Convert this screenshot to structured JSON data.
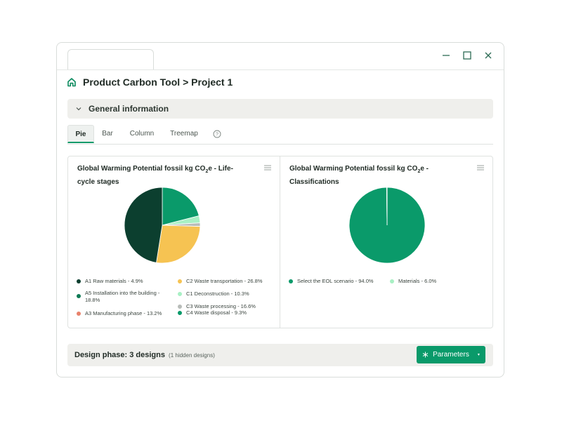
{
  "window": {
    "controls": {
      "minimize_icon": "minimize-icon",
      "maximize_icon": "maximize-icon",
      "close_icon": "close-icon"
    }
  },
  "header": {
    "icon": "home-icon",
    "title": "Product Carbon Tool > Project 1"
  },
  "section": {
    "icon": "chevron-down-icon",
    "title": "General information"
  },
  "tabs": [
    {
      "label": "Pie",
      "active": true
    },
    {
      "label": "Bar",
      "active": false
    },
    {
      "label": "Column",
      "active": false
    },
    {
      "label": "Treemap",
      "active": false
    }
  ],
  "help_icon": "help-icon",
  "charts": {
    "left": {
      "title_pre": "Global Warming Potential fossil kg CO",
      "title_sub": "2",
      "title_post": "e - Life-cycle stages"
    },
    "right": {
      "title_pre": "Global Warming Potential fossil kg CO",
      "title_sub": "2",
      "title_post": "e - Classifications"
    }
  },
  "chart_data": [
    {
      "type": "pie",
      "title": "Global Warming Potential fossil kg CO2e - Life-cycle stages",
      "legend_position": "bottom",
      "slices": [
        {
          "label": "A1 Raw materials - 4.9%",
          "value": 4.9,
          "color": "#0c3f2f"
        },
        {
          "label": "A5 Installation into the building - 18.8%",
          "value": 18.8,
          "color": "#0f7a55"
        },
        {
          "label": "A3 Manufacturing phase - 13.2%",
          "value": 13.2,
          "color": "#e8826b"
        },
        {
          "label": "C2 Waste transportation - 26.8%",
          "value": 26.8,
          "color": "#f6c352"
        },
        {
          "label": "C1 Deconstruction - 10.3%",
          "value": 10.3,
          "color": "#a8f0c4"
        },
        {
          "label": "C3 Waste processing - 16.6%",
          "value": 16.6,
          "color": "#b8bcb9"
        },
        {
          "label": "C4 Waste disposal - 9.3%",
          "value": 9.3,
          "color": "#0a9a6a"
        }
      ],
      "rendered_sectors": [
        {
          "value": 21,
          "color": "#0a9a6a"
        },
        {
          "value": 3,
          "color": "#a8f0c4"
        },
        {
          "value": 1.5,
          "color": "#b8bcb9"
        },
        {
          "value": 27,
          "color": "#f6c352"
        },
        {
          "value": 47.5,
          "color": "#0c3f2f"
        }
      ]
    },
    {
      "type": "pie",
      "title": "Global Warming Potential fossil kg CO2e - Classifications",
      "legend_position": "bottom",
      "slices": [
        {
          "label": "Select the EOL scenario - 94.0%",
          "value": 94.0,
          "color": "#0a9a6a"
        },
        {
          "label": "Materials - 6.0%",
          "value": 6.0,
          "color": "#a8f0c4"
        }
      ],
      "rendered_sectors": [
        {
          "value": 99.8,
          "color": "#0a9a6a"
        },
        {
          "value": 0.2,
          "color": "#ffffff"
        }
      ]
    }
  ],
  "footer": {
    "label": "Design phase: 3 designs",
    "sublabel": "(1 hidden designs)",
    "button_icon": "snowflake-icon",
    "button_label": "Parameters",
    "button_caret": "▾"
  }
}
